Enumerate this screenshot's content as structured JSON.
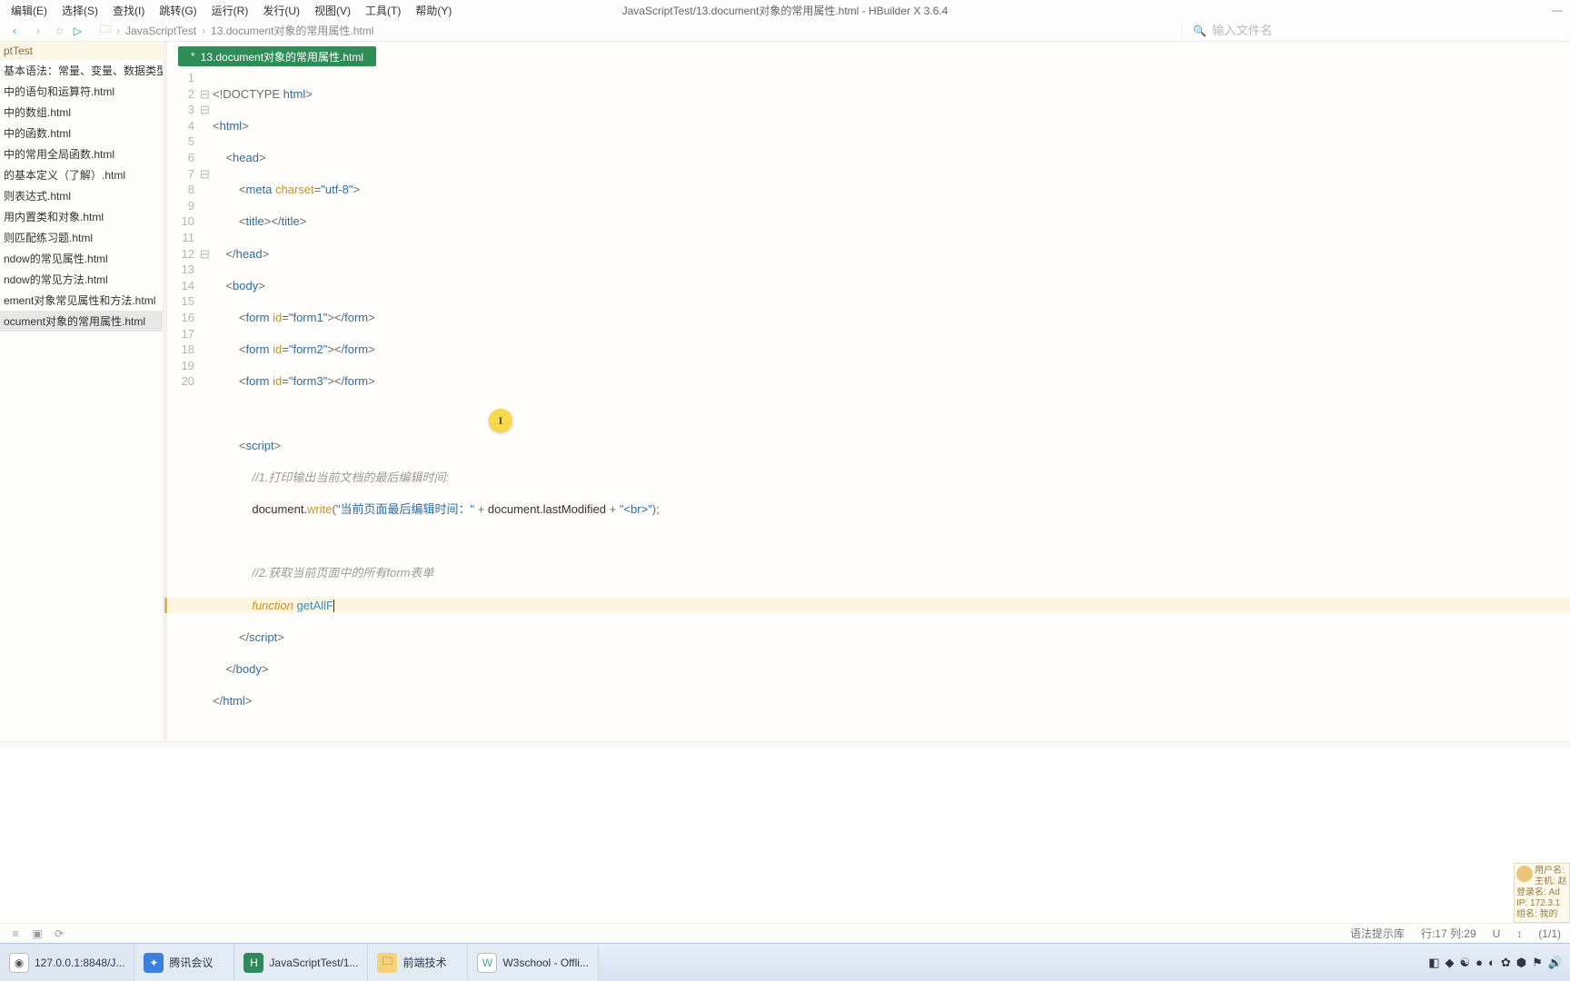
{
  "window": {
    "title": "JavaScriptTest/13.document对象的常用属性.html - HBuilder X 3.6.4"
  },
  "menu": {
    "edit": "编辑(E)",
    "select": "选择(S)",
    "find": "查找(I)",
    "goto": "跳转(G)",
    "run": "运行(R)",
    "publish": "发行(U)",
    "view": "视图(V)",
    "tool": "工具(T)",
    "help": "帮助(Y)"
  },
  "breadcrumb": {
    "project": "JavaScriptTest",
    "file": "13.document对象的常用属性.html"
  },
  "search": {
    "placeholder": "输入文件名"
  },
  "sidebar": {
    "project": "ptTest",
    "items": [
      "基本语法：常量、变量、数据类型.html",
      "中的语句和运算符.html",
      "中的数组.html",
      "中的函数.html",
      "中的常用全局函数.html",
      "的基本定义（了解）.html",
      "则表达式.html",
      "用内置类和对象.html",
      "则匹配练习题.html",
      "ndow的常见属性.html",
      "ndow的常见方法.html",
      "ement对象常见属性和方法.html",
      "ocument对象的常用属性.html"
    ],
    "activeIndex": 12
  },
  "tab": {
    "label": "13.document对象的常用属性.html",
    "dirty": "*"
  },
  "code": {
    "l1a": "<!DOCTYPE ",
    "l1b": "html",
    "l1c": ">",
    "l2a": "<",
    "l2b": "html",
    "l2c": ">",
    "l3a": "<",
    "l3b": "head",
    "l3c": ">",
    "l4a": "<",
    "l4b": "meta ",
    "l4attr": "charset",
    "l4eq": "=",
    "l4str": "\"utf-8\"",
    "l4c": ">",
    "l5a": "<",
    "l5b": "title",
    "l5c": "></",
    "l5d": "title",
    "l5e": ">",
    "l6a": "</",
    "l6b": "head",
    "l6c": ">",
    "l7a": "<",
    "l7b": "body",
    "l7c": ">",
    "l8a": "<",
    "l8b": "form ",
    "l8attr": "id",
    "l8eq": "=",
    "l8str": "\"form1\"",
    "l8c": "></",
    "l8d": "form",
    "l8e": ">",
    "l9a": "<",
    "l9b": "form ",
    "l9attr": "id",
    "l9eq": "=",
    "l9str": "\"form2\"",
    "l9c": "></",
    "l9d": "form",
    "l9e": ">",
    "l10a": "<",
    "l10b": "form ",
    "l10attr": "id",
    "l10eq": "=",
    "l10str": "\"form3\"",
    "l10c": "></",
    "l10d": "form",
    "l10e": ">",
    "l12a": "<",
    "l12b": "script",
    "l12c": ">",
    "l13": "//1.打印输出当前文档的最后编辑时间:",
    "l14a": "document.",
    "l14b": "write",
    "l14c": "(",
    "l14str1": "\"当前页面最后编辑时间：\"",
    "l14p1": " + ",
    "l14d": "document.lastModified",
    "l14p2": " + ",
    "l14str2": "\"<br>\"",
    "l14e": ");",
    "l16": "//2.获取当前页面中的所有form表单",
    "l17a": "function",
    "l17b": " getAllF",
    "l18a": "</",
    "l18b": "script",
    "l18c": ">",
    "l19a": "</",
    "l19b": "body",
    "l19c": ">",
    "l20a": "</",
    "l20b": "html",
    "l20c": ">"
  },
  "lineNumbers": [
    "1",
    "2",
    "3",
    "4",
    "5",
    "6",
    "7",
    "8",
    "9",
    "10",
    "11",
    "12",
    "13",
    "14",
    "15",
    "16",
    "17",
    "18",
    "19",
    "20"
  ],
  "folds": [
    "",
    "⊟",
    "⊟",
    "",
    "",
    "",
    "⊟",
    "",
    "",
    "",
    "",
    "⊟",
    "",
    "",
    "",
    "",
    "",
    "",
    "",
    ""
  ],
  "status": {
    "syntax": "语法提示库",
    "pos": "行:17  列:29",
    "enc": "U",
    "count": "(1/1)",
    "arrow": "↕"
  },
  "netpanel": {
    "user": "用户名: 赵赵",
    "host": "主机: 赵艳",
    "login": "登录名: Ad",
    "ip": "IP: 172.3.1",
    "group": "组名: 我的"
  },
  "taskbar": {
    "browser": "127.0.0.1:8848/J...",
    "meeting": "腾讯会议",
    "hbuilder": "JavaScriptTest/1...",
    "folder": "前端技术",
    "w3": "W3school - Offli..."
  }
}
